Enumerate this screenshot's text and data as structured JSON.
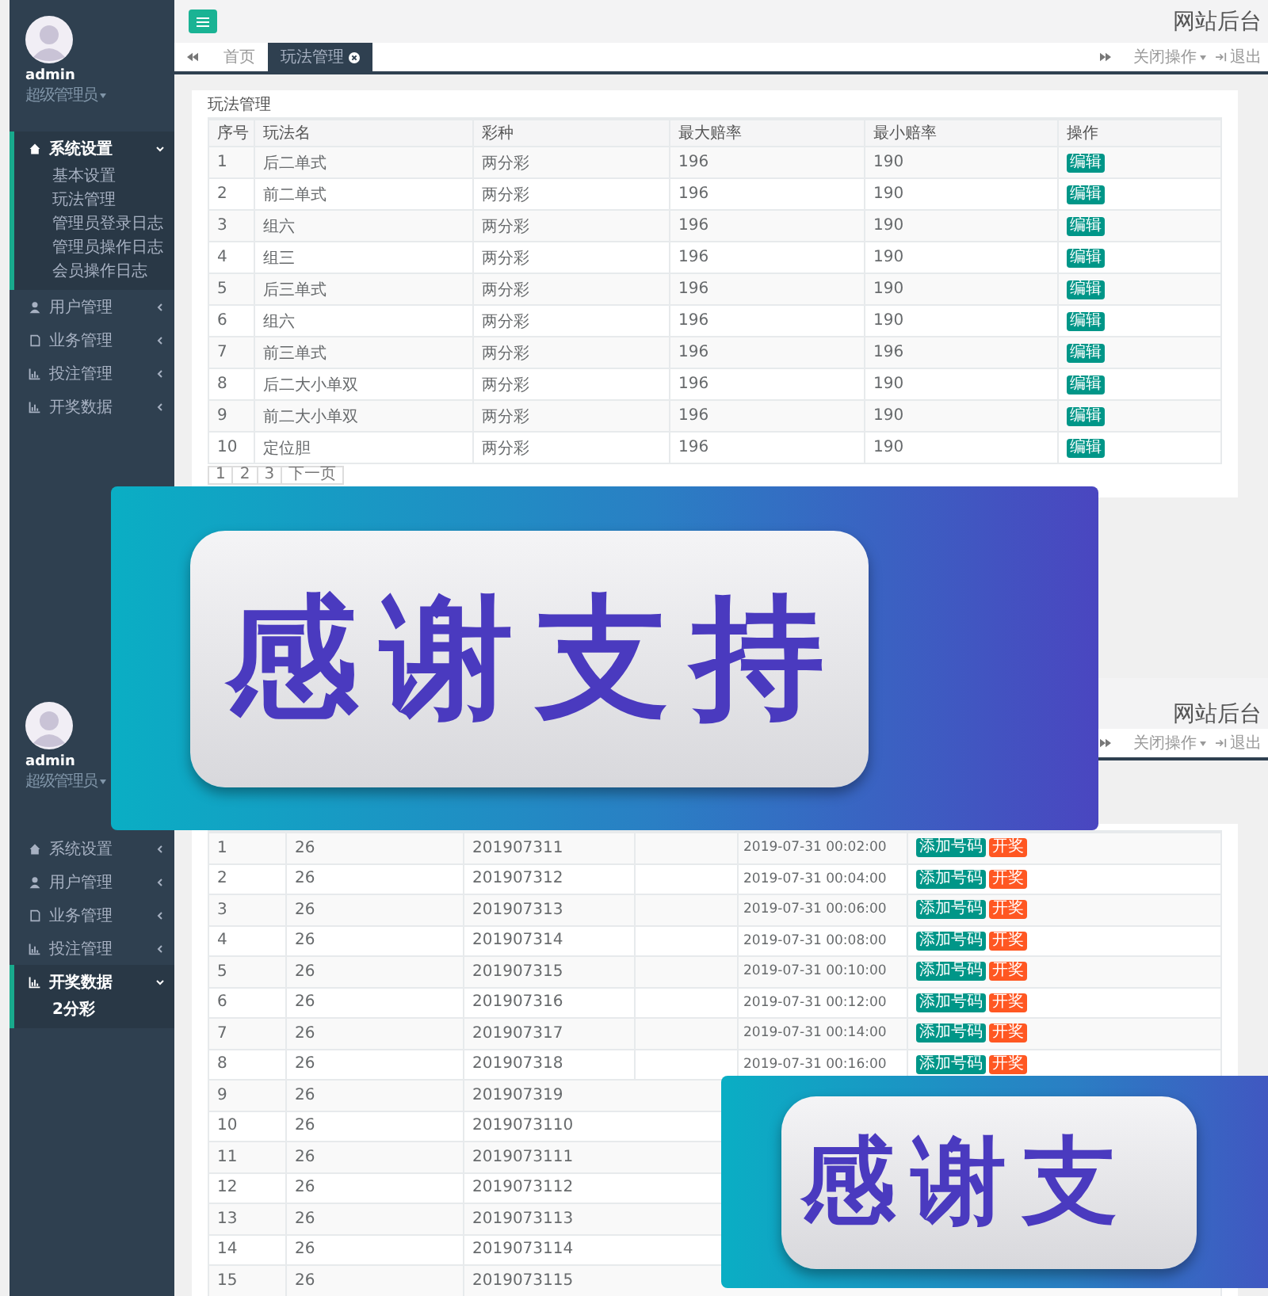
{
  "panels": [
    {
      "kind": "plays",
      "header": {
        "title": "网站后台"
      },
      "user": {
        "name": "admin",
        "role": "超级管理员"
      },
      "menu": [
        {
          "label": "系统设置",
          "expanded": true,
          "children": [
            "基本设置",
            "玩法管理",
            "管理员登录日志",
            "管理员操作日志",
            "会员操作日志"
          ]
        },
        {
          "label": "用户管理",
          "expanded": false
        },
        {
          "label": "业务管理",
          "expanded": false
        },
        {
          "label": "投注管理",
          "expanded": false
        },
        {
          "label": "开奖数据",
          "expanded": false
        }
      ],
      "tabs": [
        {
          "label": "首页",
          "selected": false
        },
        {
          "label": "玩法管理",
          "selected": true
        }
      ],
      "tools": [
        "关闭操作",
        "退出"
      ],
      "card_title": "玩法管理",
      "columns": [
        "序号",
        "玩法名",
        "彩种",
        "最大赔率",
        "最小赔率",
        "操作"
      ],
      "rows": [
        {
          "cells": [
            "1",
            "后二单式",
            "两分彩",
            "196",
            "190"
          ],
          "actions": [
            "编辑"
          ]
        },
        {
          "cells": [
            "2",
            "前二单式",
            "两分彩",
            "196",
            "190"
          ],
          "actions": [
            "编辑"
          ]
        },
        {
          "cells": [
            "3",
            "组六",
            "两分彩",
            "196",
            "190"
          ],
          "actions": [
            "编辑"
          ]
        },
        {
          "cells": [
            "4",
            "组三",
            "两分彩",
            "196",
            "190"
          ],
          "actions": [
            "编辑"
          ]
        },
        {
          "cells": [
            "5",
            "后三单式",
            "两分彩",
            "196",
            "190"
          ],
          "actions": [
            "编辑"
          ]
        },
        {
          "cells": [
            "6",
            "组六",
            "两分彩",
            "196",
            "190"
          ],
          "actions": [
            "编辑"
          ]
        },
        {
          "cells": [
            "7",
            "前三单式",
            "两分彩",
            "196",
            "196"
          ],
          "actions": [
            "编辑"
          ]
        },
        {
          "cells": [
            "8",
            "后二大小单双",
            "两分彩",
            "196",
            "190"
          ],
          "actions": [
            "编辑"
          ]
        },
        {
          "cells": [
            "9",
            "前二大小单双",
            "两分彩",
            "196",
            "190"
          ],
          "actions": [
            "编辑"
          ]
        },
        {
          "cells": [
            "10",
            "定位胆",
            "两分彩",
            "196",
            "190"
          ],
          "actions": [
            "编辑"
          ]
        }
      ],
      "pagination": [
        "1",
        "2",
        "3",
        "下一页"
      ]
    },
    {
      "kind": "draws",
      "header": {
        "title": "网站后台"
      },
      "user": {
        "name": "admin",
        "role": "超级管理员"
      },
      "menu": [
        {
          "label": "系统设置",
          "expanded": false
        },
        {
          "label": "用户管理",
          "expanded": false
        },
        {
          "label": "业务管理",
          "expanded": false
        },
        {
          "label": "投注管理",
          "expanded": false
        },
        {
          "label": "开奖数据",
          "expanded": true,
          "children": [
            "2分彩"
          ]
        }
      ],
      "tools": [
        "关闭操作",
        "退出"
      ],
      "rows": [
        {
          "cells": [
            "1",
            "26",
            "201907311",
            "2019-07-31 00:02:00"
          ],
          "actions": [
            "添加号码",
            "开奖"
          ]
        },
        {
          "cells": [
            "2",
            "26",
            "201907312",
            "2019-07-31 00:04:00"
          ],
          "actions": [
            "添加号码",
            "开奖"
          ]
        },
        {
          "cells": [
            "3",
            "26",
            "201907313",
            "2019-07-31 00:06:00"
          ],
          "actions": [
            "添加号码",
            "开奖"
          ]
        },
        {
          "cells": [
            "4",
            "26",
            "201907314",
            "2019-07-31 00:08:00"
          ],
          "actions": [
            "添加号码",
            "开奖"
          ]
        },
        {
          "cells": [
            "5",
            "26",
            "201907315",
            "2019-07-31 00:10:00"
          ],
          "actions": [
            "添加号码",
            "开奖"
          ]
        },
        {
          "cells": [
            "6",
            "26",
            "201907316",
            "2019-07-31 00:12:00"
          ],
          "actions": [
            "添加号码",
            "开奖"
          ]
        },
        {
          "cells": [
            "7",
            "26",
            "201907317",
            "2019-07-31 00:14:00"
          ],
          "actions": [
            "添加号码",
            "开奖"
          ]
        },
        {
          "cells": [
            "8",
            "26",
            "201907318",
            "2019-07-31 00:16:00"
          ],
          "actions": [
            "添加号码",
            "开奖"
          ]
        },
        {
          "cells": [
            "9",
            "26",
            "201907319"
          ]
        },
        {
          "cells": [
            "10",
            "26",
            "2019073110"
          ]
        },
        {
          "cells": [
            "11",
            "26",
            "2019073111"
          ]
        },
        {
          "cells": [
            "12",
            "26",
            "2019073112"
          ]
        },
        {
          "cells": [
            "13",
            "26",
            "2019073113"
          ]
        },
        {
          "cells": [
            "14",
            "26",
            "2019073114"
          ]
        },
        {
          "cells": [
            "15",
            "26",
            "2019073115"
          ]
        }
      ]
    }
  ],
  "banners": [
    {
      "text": "感谢支持"
    },
    {
      "text": "感谢支"
    }
  ]
}
